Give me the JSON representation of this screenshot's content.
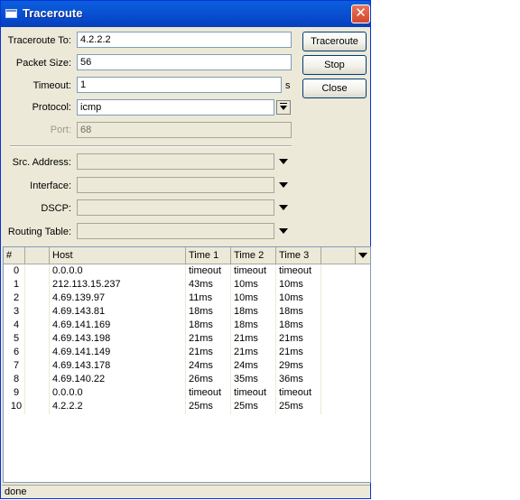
{
  "window": {
    "title": "Traceroute"
  },
  "form": {
    "traceroute_to": {
      "label": "Traceroute To:",
      "value": "4.2.2.2"
    },
    "packet_size": {
      "label": "Packet Size:",
      "value": "56"
    },
    "timeout": {
      "label": "Timeout:",
      "value": "1",
      "unit": "s"
    },
    "protocol": {
      "label": "Protocol:",
      "value": "icmp"
    },
    "port": {
      "label": "Port:",
      "value": "68"
    },
    "src_address": {
      "label": "Src. Address:",
      "value": ""
    },
    "interface": {
      "label": "Interface:",
      "value": ""
    },
    "dscp": {
      "label": "DSCP:",
      "value": ""
    },
    "routing_table": {
      "label": "Routing Table:",
      "value": ""
    }
  },
  "buttons": {
    "traceroute": "Traceroute",
    "stop": "Stop",
    "close": "Close"
  },
  "table": {
    "columns": [
      "#",
      "Host",
      "Time 1",
      "Time 2",
      "Time 3"
    ],
    "rows": [
      {
        "n": "0",
        "host": "0.0.0.0",
        "t1": "timeout",
        "t2": "timeout",
        "t3": "timeout"
      },
      {
        "n": "1",
        "host": "212.113.15.237",
        "t1": "43ms",
        "t2": "10ms",
        "t3": "10ms"
      },
      {
        "n": "2",
        "host": "4.69.139.97",
        "t1": "11ms",
        "t2": "10ms",
        "t3": "10ms"
      },
      {
        "n": "3",
        "host": "4.69.143.81",
        "t1": "18ms",
        "t2": "18ms",
        "t3": "18ms"
      },
      {
        "n": "4",
        "host": "4.69.141.169",
        "t1": "18ms",
        "t2": "18ms",
        "t3": "18ms"
      },
      {
        "n": "5",
        "host": "4.69.143.198",
        "t1": "21ms",
        "t2": "21ms",
        "t3": "21ms"
      },
      {
        "n": "6",
        "host": "4.69.141.149",
        "t1": "21ms",
        "t2": "21ms",
        "t3": "21ms"
      },
      {
        "n": "7",
        "host": "4.69.143.178",
        "t1": "24ms",
        "t2": "24ms",
        "t3": "29ms"
      },
      {
        "n": "8",
        "host": "4.69.140.22",
        "t1": "26ms",
        "t2": "35ms",
        "t3": "36ms"
      },
      {
        "n": "9",
        "host": "0.0.0.0",
        "t1": "timeout",
        "t2": "timeout",
        "t3": "timeout"
      },
      {
        "n": "10",
        "host": "4.2.2.2",
        "t1": "25ms",
        "t2": "25ms",
        "t3": "25ms"
      }
    ]
  },
  "status": "done",
  "icons": {
    "title": "window-icon",
    "close": "close-icon",
    "dropdown": "chevron-down-icon"
  },
  "colors": {
    "titlebar": "#0a5fdc",
    "close": "#d5462b",
    "dialog": "#ece9d8"
  }
}
